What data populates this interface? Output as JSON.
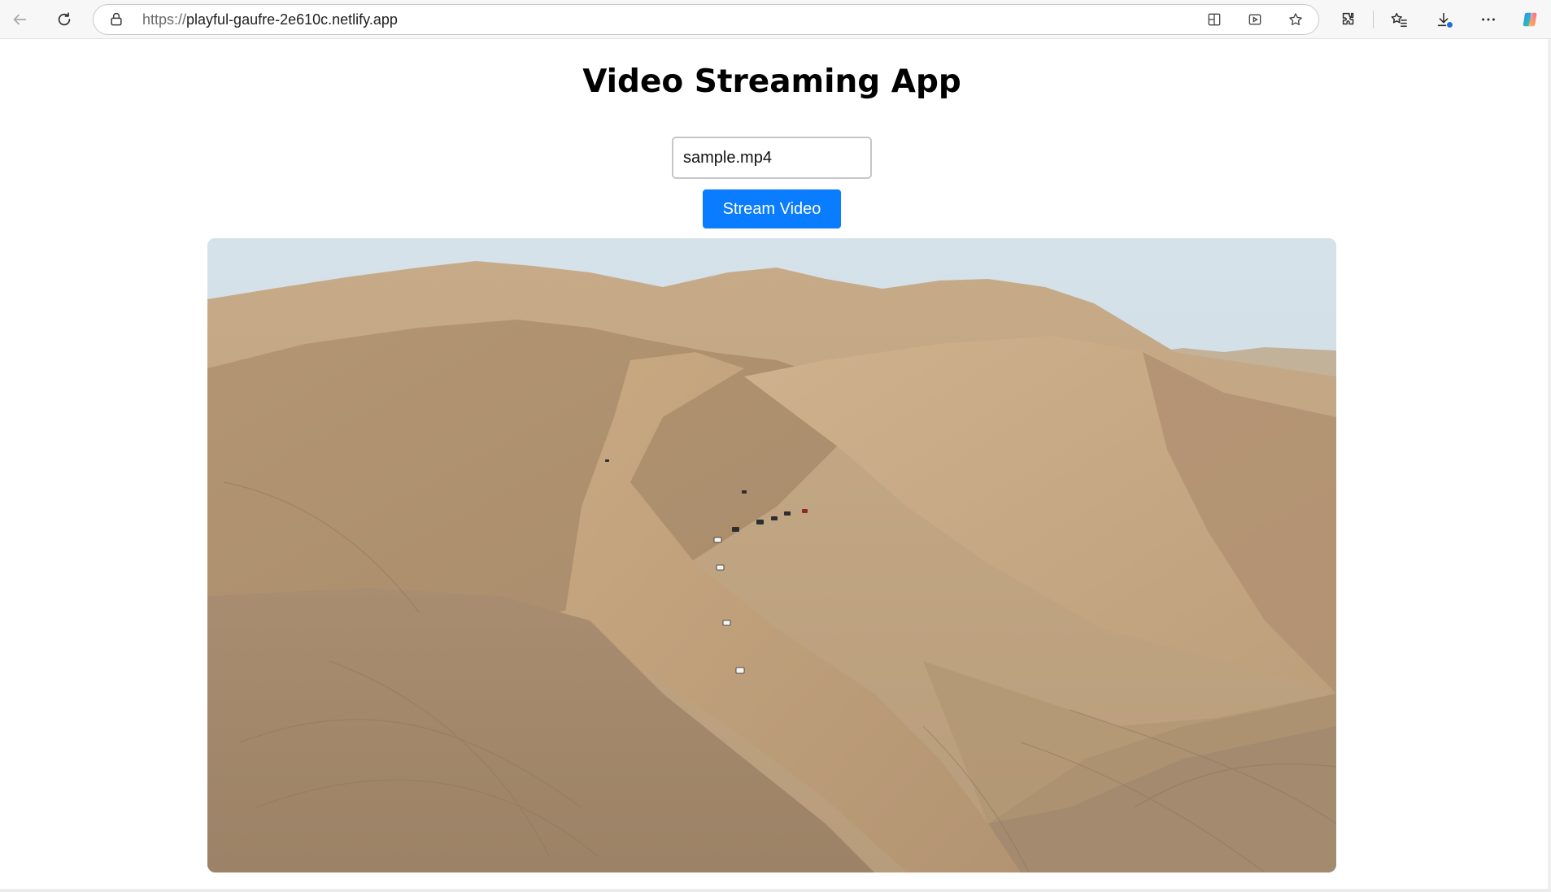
{
  "browser": {
    "url_protocol": "https://",
    "url_host": "playful-gaufre-2e610c.netlify.app",
    "icons": {
      "back": "arrow-left-icon",
      "reload": "refresh-icon",
      "lock": "lock-icon",
      "split_screen": "split-screen-icon",
      "immersive_reader": "immersive-reader-icon",
      "favorite": "star-icon",
      "extensions": "puzzle-icon",
      "favorites_list": "favorites-icon",
      "downloads": "download-icon",
      "menu": "more-icon",
      "copilot": "copilot-icon"
    }
  },
  "page": {
    "title": "Video Streaming App",
    "file_input_value": "sample.mp4",
    "stream_button_label": "Stream Video",
    "accent_color": "#0a7cff"
  }
}
